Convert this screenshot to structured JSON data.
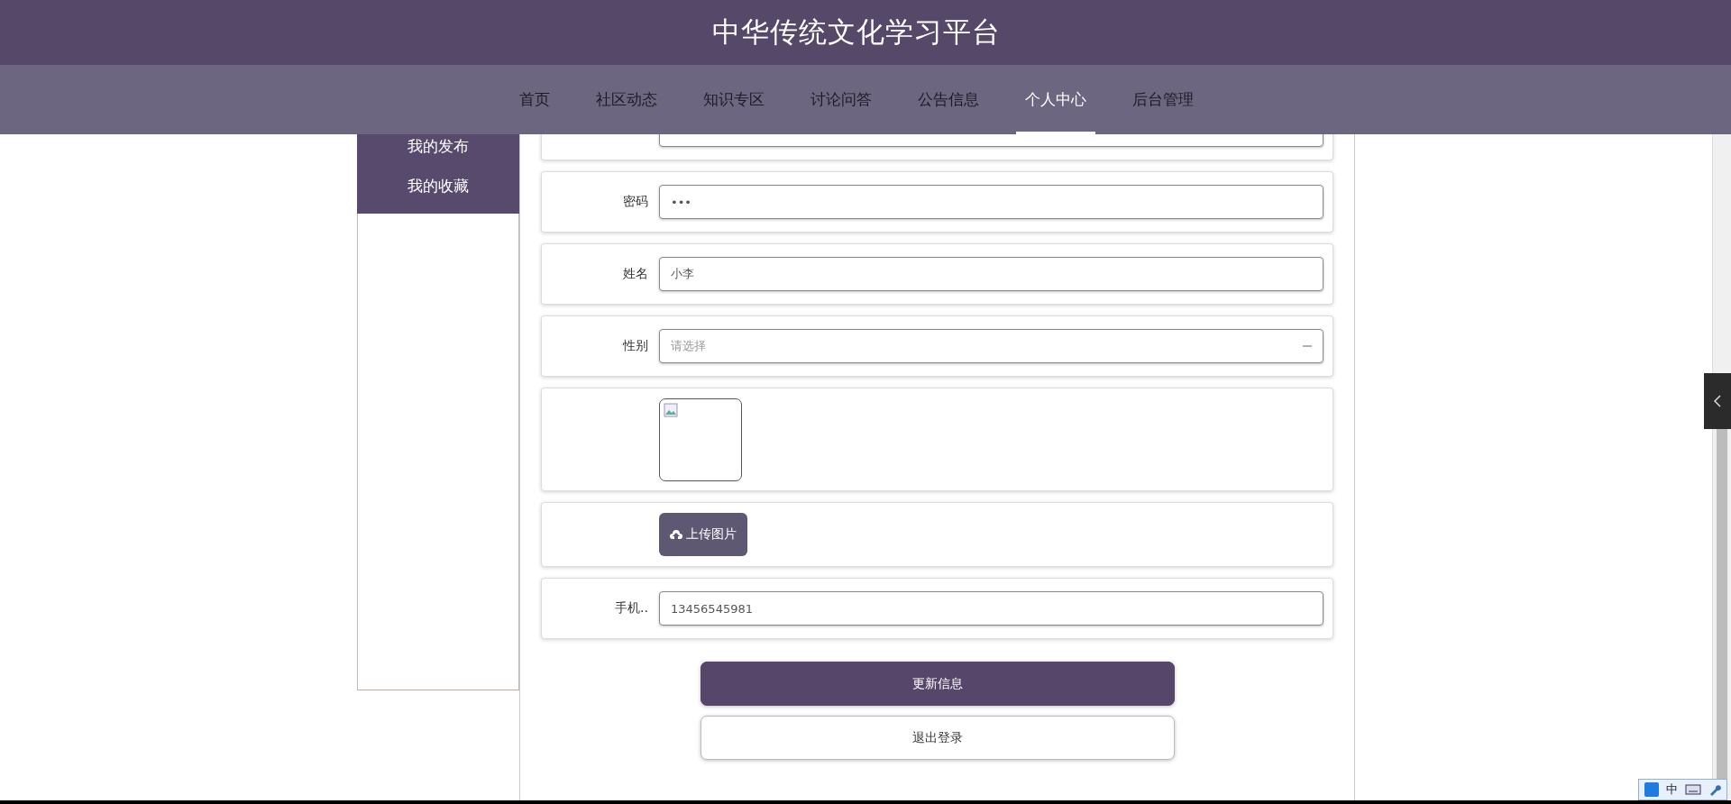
{
  "header": {
    "title": "中华传统文化学习平台"
  },
  "nav": [
    {
      "label": "首页",
      "selected": false
    },
    {
      "label": "社区动态",
      "selected": false
    },
    {
      "label": "知识专区",
      "selected": false
    },
    {
      "label": "讨论问答",
      "selected": false
    },
    {
      "label": "公告信息",
      "selected": false
    },
    {
      "label": "个人中心",
      "selected": true
    },
    {
      "label": "后台管理",
      "selected": false
    }
  ],
  "sidebar": {
    "items": [
      {
        "label": "我的发布"
      },
      {
        "label": "我的收藏"
      }
    ]
  },
  "form": {
    "rows": [
      {
        "kind": "input"
      },
      {
        "kind": "input",
        "label": "密码",
        "value": "•••"
      },
      {
        "kind": "input",
        "label": "姓名",
        "value": "小李"
      },
      {
        "kind": "select",
        "label": "性别",
        "placeholder": "请选择"
      },
      {
        "kind": "image"
      },
      {
        "kind": "upload",
        "button": "上传图片"
      },
      {
        "kind": "input",
        "label": "手机..",
        "value": "13456545981"
      }
    ]
  },
  "buttons": [
    {
      "kind": "primary",
      "label": "更新信息"
    },
    {
      "kind": "secondary",
      "label": "退出登录"
    }
  ],
  "ime_toolbar": {
    "language": "中"
  }
}
